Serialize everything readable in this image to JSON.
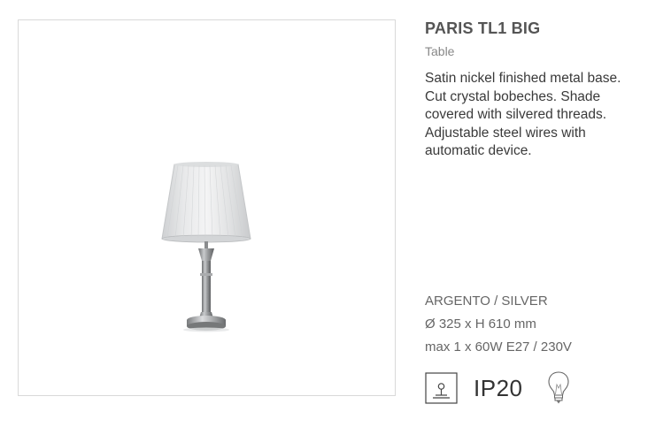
{
  "product": {
    "name": "PARIS TL1 BIG",
    "category": "Table",
    "description_lines": [
      "Satin nickel finished metal base.",
      "Cut crystal bobeches. Shade",
      "covered with silvered threads.",
      "Adjustable steel wires with",
      "automatic device."
    ],
    "finish": "ARGENTO / SILVER",
    "dimensions": "Ø 325 x H 610 mm",
    "lamp_spec": "max 1 x 60W E27 / 230V",
    "ip_rating": "IP20"
  },
  "icons": {
    "table_lamp_symbol": "table-lamp-icon",
    "light_bulb": "light-bulb-icon"
  },
  "colors": {
    "title": "#555555",
    "text": "#3a3a3a",
    "muted": "#888888",
    "frame_border": "#d9d9d9"
  }
}
